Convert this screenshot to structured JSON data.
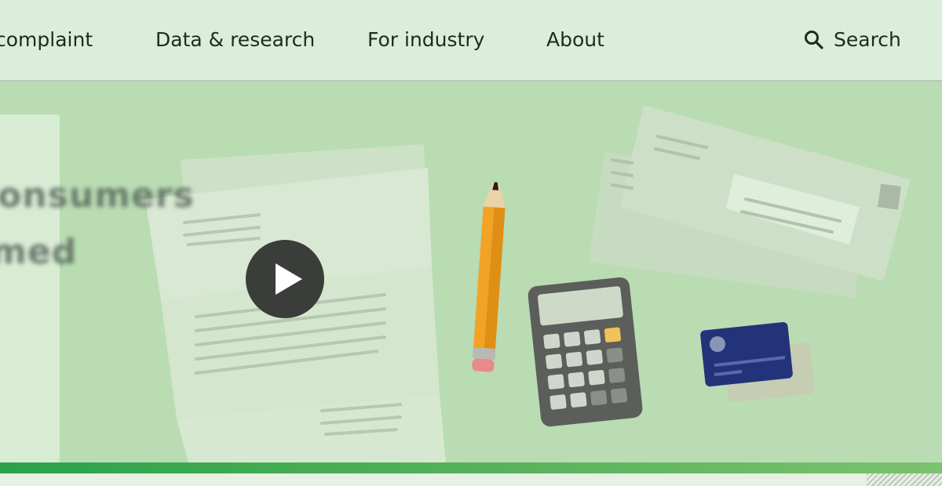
{
  "nav": {
    "items": [
      {
        "label": "complaint"
      },
      {
        "label": "Data & research"
      },
      {
        "label": "For industry"
      },
      {
        "label": "About"
      }
    ],
    "search_label": "Search"
  },
  "hero": {
    "blurred_text_1": "consumers",
    "blurred_text_2": "med"
  },
  "colors": {
    "nav_bg": "#dbeedb",
    "hero_bg": "#b9dcb2",
    "accent_green": "#2aa24a",
    "play_button": "#3b3d3b"
  }
}
